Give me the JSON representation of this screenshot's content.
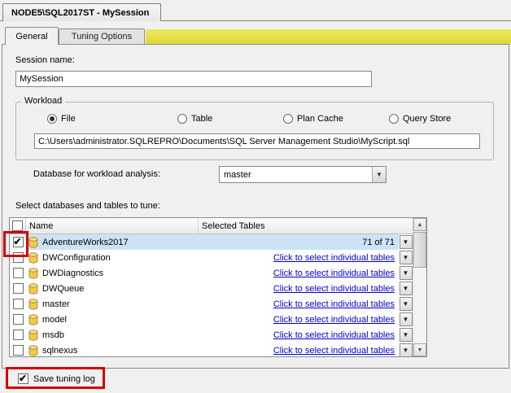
{
  "window": {
    "title_tab": "NODE5\\SQL2017ST - MySession"
  },
  "tabs": {
    "general": "General",
    "tuning_options": "Tuning Options"
  },
  "general_tab": {
    "session_name_label": "Session name:",
    "session_name_value": "MySession",
    "workload": {
      "group_label": "Workload",
      "radio_file": "File",
      "radio_table": "Table",
      "radio_plan_cache": "Plan Cache",
      "radio_query_store": "Query Store",
      "selected_radio": "File",
      "file_path": "C:\\Users\\administrator.SQLREPRO\\Documents\\SQL Server Management Studio\\MyScript.sql",
      "database_label": "Database for workload analysis:",
      "database_selected": "master"
    },
    "tune_section": {
      "label": "Select databases and tables to tune:",
      "columns": {
        "name": "Name",
        "selected_tables": "Selected Tables"
      },
      "rows": [
        {
          "name": "AdventureWorks2017",
          "checked": true,
          "selected_tables": "71 of 71"
        },
        {
          "name": "DWConfiguration",
          "checked": false,
          "selected_tables": "Click to select individual tables"
        },
        {
          "name": "DWDiagnostics",
          "checked": false,
          "selected_tables": "Click to select individual tables"
        },
        {
          "name": "DWQueue",
          "checked": false,
          "selected_tables": "Click to select individual tables"
        },
        {
          "name": "master",
          "checked": false,
          "selected_tables": "Click to select individual tables"
        },
        {
          "name": "model",
          "checked": false,
          "selected_tables": "Click to select individual tables"
        },
        {
          "name": "msdb",
          "checked": false,
          "selected_tables": "Click to select individual tables"
        },
        {
          "name": "sqlnexus",
          "checked": false,
          "selected_tables": "Click to select individual tables"
        }
      ]
    },
    "save_tuning_log_label": "Save tuning log",
    "save_tuning_log_checked": true
  },
  "colors": {
    "background": "#f0f0f0",
    "row_highlight": "#cbe3f5",
    "link": "#0000cc",
    "annotation_red": "#d40000",
    "tab_accent_yellow": "#ddd838",
    "db_icon_yellow": "#f2c94c"
  }
}
